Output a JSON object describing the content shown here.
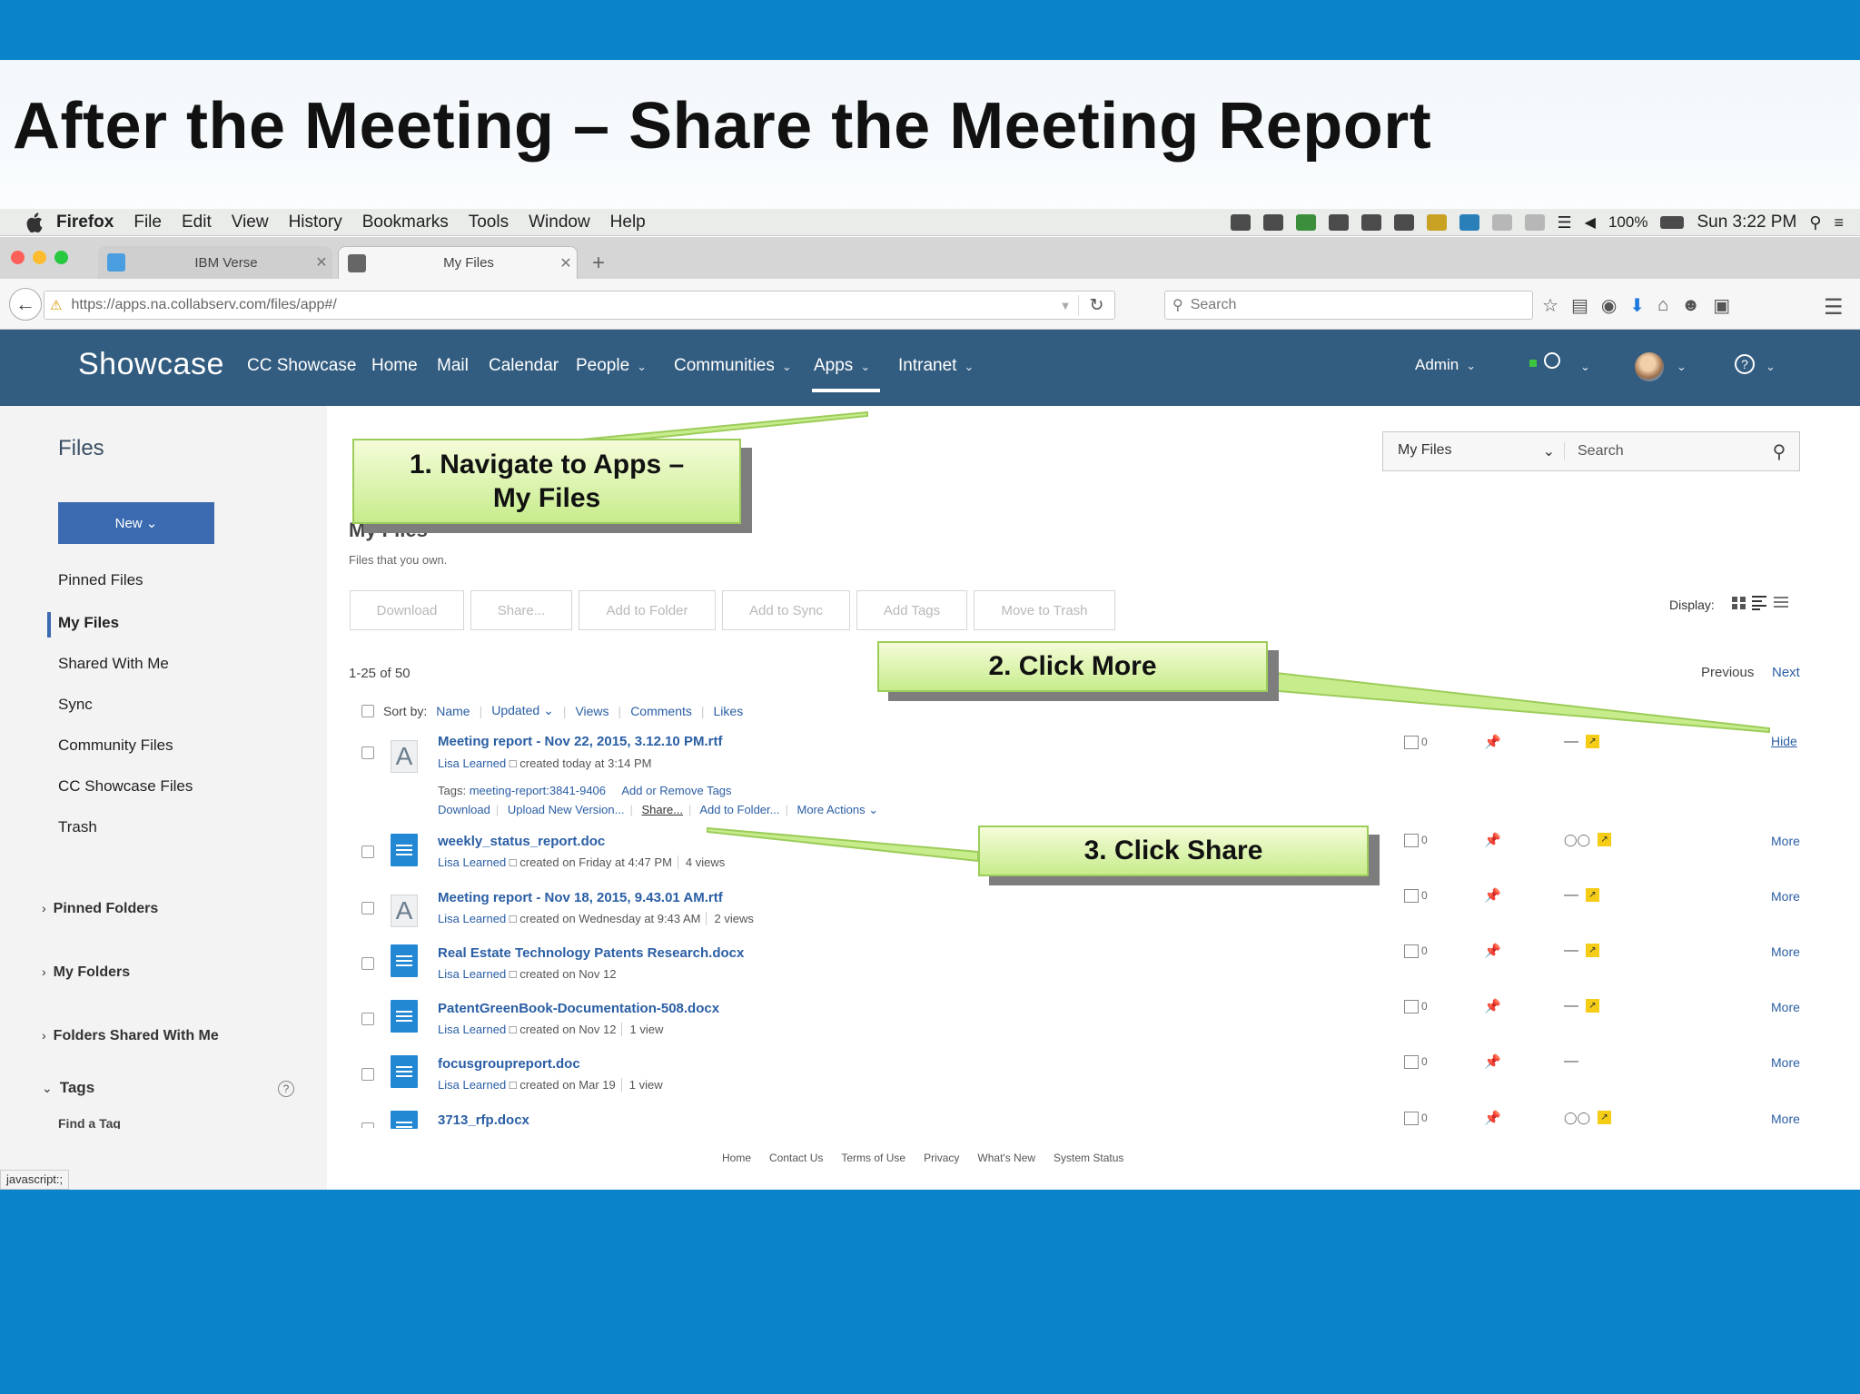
{
  "slide": {
    "title": "After the Meeting – Share the Meeting Report"
  },
  "menubar": {
    "items": [
      "Firefox",
      "File",
      "Edit",
      "View",
      "History",
      "Bookmarks",
      "Tools",
      "Window",
      "Help"
    ],
    "battery": "100%",
    "clock": "Sun 3:22 PM"
  },
  "browser": {
    "tabs": [
      {
        "label": "IBM Verse",
        "icon": "verse-icon",
        "active": false
      },
      {
        "label": "My Files",
        "icon": "files-icon",
        "active": true
      }
    ],
    "url": "https://apps.na.collabserv.com/files/app#/",
    "search_placeholder": "Search"
  },
  "app": {
    "brand": "Showcase",
    "nav": [
      "CC Showcase",
      "Home",
      "Mail",
      "Calendar",
      "People",
      "Communities",
      "Apps",
      "Intranet"
    ],
    "active_nav": "Apps",
    "admin": "Admin"
  },
  "sidebar": {
    "title": "Files",
    "new_button": "New",
    "items": [
      "Pinned Files",
      "My Files",
      "Shared With Me",
      "Sync",
      "Community Files",
      "CC Showcase Files",
      "Trash"
    ],
    "selected": "My Files",
    "sections": [
      "Pinned Folders",
      "My Folders",
      "Folders Shared With Me",
      "Tags"
    ],
    "find_tag": "Find a Tag"
  },
  "main": {
    "search_scope": "My Files",
    "search_placeholder": "Search",
    "heading": "My Files",
    "subheading": "Files that you own.",
    "actions": [
      "Download",
      "Share...",
      "Add to Folder",
      "Add to Sync",
      "Add Tags",
      "Move to Trash"
    ],
    "display_label": "Display:",
    "count": "1-25 of 50",
    "previous": "Previous",
    "next": "Next",
    "sort_label": "Sort by:",
    "sort_options": [
      "Name",
      "Updated",
      "Views",
      "Comments",
      "Likes"
    ],
    "expanded": {
      "tags_label": "Tags:",
      "tag": "meeting-report:3841-9406",
      "add_tags": "Add or Remove Tags",
      "actions": [
        "Download",
        "Upload New Version...",
        "Share...",
        "Add to Folder...",
        "More Actions"
      ],
      "hide": "Hide"
    },
    "files": [
      {
        "name": "Meeting report - Nov 22, 2015, 3.12.10 PM.rtf",
        "owner": "Lisa Learned",
        "created": "created today at 3:14 PM",
        "views": "",
        "type": "rtf",
        "comments": "0",
        "share": "—",
        "link": "Hide"
      },
      {
        "name": "weekly_status_report.doc",
        "owner": "Lisa Learned",
        "created": "created on Friday at 4:47 PM",
        "views": "4 views",
        "type": "doc",
        "comments": "0",
        "share": "people",
        "link": "More"
      },
      {
        "name": "Meeting report - Nov 18, 2015, 9.43.01 AM.rtf",
        "owner": "Lisa Learned",
        "created": "created on Wednesday at 9:43 AM",
        "views": "2 views",
        "type": "rtf",
        "comments": "0",
        "share": "—",
        "link": "More"
      },
      {
        "name": "Real Estate Technology Patents Research.docx",
        "owner": "Lisa Learned",
        "created": "created on Nov 12",
        "views": "",
        "type": "doc",
        "comments": "0",
        "share": "—",
        "link": "More"
      },
      {
        "name": "PatentGreenBook-Documentation-508.docx",
        "owner": "Lisa Learned",
        "created": "created on Nov 12",
        "views": "1 view",
        "type": "doc",
        "comments": "0",
        "share": "—",
        "link": "More"
      },
      {
        "name": "focusgroupreport.doc",
        "owner": "Lisa Learned",
        "created": "created on Mar 19",
        "views": "1 view",
        "type": "doc",
        "comments": "0",
        "share": "—",
        "link": "More"
      },
      {
        "name": "3713_rfp.docx",
        "owner": "",
        "created": "",
        "views": "",
        "type": "doc",
        "comments": "0",
        "share": "people",
        "link": "More"
      }
    ],
    "footer": [
      "Home",
      "Contact Us",
      "Terms of Use",
      "Privacy",
      "What's New",
      "System Status"
    ]
  },
  "status_bar": "javascript:;",
  "callouts": {
    "step1_line1": "1. Navigate to Apps –",
    "step1_line2": "My Files",
    "step2": "2. Click More",
    "step3": "3. Click Share"
  },
  "colors": {
    "brand_blue": "#0a83cb",
    "header": "#325c80",
    "link": "#2a5ea4",
    "callout": "#c7ec8c"
  }
}
